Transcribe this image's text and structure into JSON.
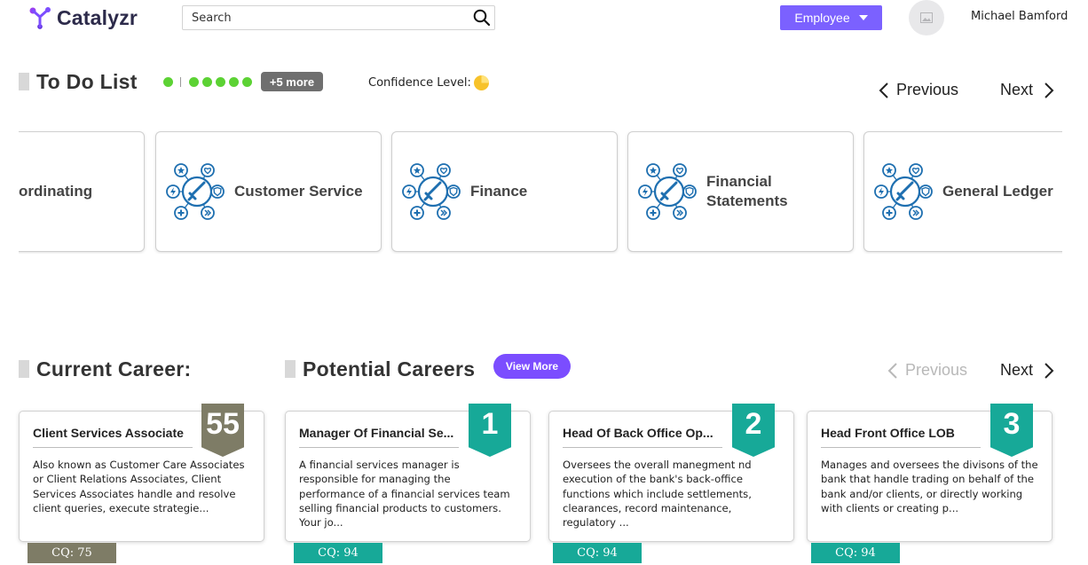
{
  "header": {
    "logo_text": "Catalyzr",
    "search_placeholder": "Search",
    "role_selected": "Employee",
    "user_name": "Michael Bamford"
  },
  "todo": {
    "title": "To Do List",
    "more_label": "+5 more",
    "confidence_label": "Confidence Level:",
    "prev_label": "Previous",
    "next_label": "Next",
    "dot_color": "#5cd234",
    "skills": [
      {
        "label": "ordinating"
      },
      {
        "label": "Customer Service"
      },
      {
        "label": "Finance"
      },
      {
        "label": "Financial Statements"
      },
      {
        "label": "General Ledger"
      }
    ]
  },
  "careers": {
    "current_title": "Current Career:",
    "potential_title": "Potential Careers",
    "view_more_label": "View More",
    "prev_label": "Previous",
    "next_label": "Next",
    "current": {
      "title": "Client Services Associate",
      "description": "Also known as Customer Care Associates or Client Relations Associates, Client Services Associates handle and resolve client queries, execute strategie...",
      "rank": "55",
      "cq": "CQ: 75",
      "color": "#7e7c66"
    },
    "potential": [
      {
        "title": "Manager Of Financial Se...",
        "description": "A financial services manager is responsible for managing the performance of a financial services team selling financial products to customers. Your jo...",
        "rank": "1",
        "cq": "CQ: 94",
        "color": "#17a998"
      },
      {
        "title": "Head Of Back Office Op...",
        "description": "Oversees the overall manegment nd execution of the bank's back-office functions which include settlements, clearances, record maintenance, regulatory ...",
        "rank": "2",
        "cq": "CQ: 94",
        "color": "#17a998"
      },
      {
        "title": "Head Front Office LOB",
        "description": "Manages and oversees the divisons of the bank that handle trading on behalf of the bank and/or clients, or directly working with clients or creating p...",
        "rank": "3",
        "cq": "CQ: 94",
        "color": "#17a998"
      }
    ]
  }
}
